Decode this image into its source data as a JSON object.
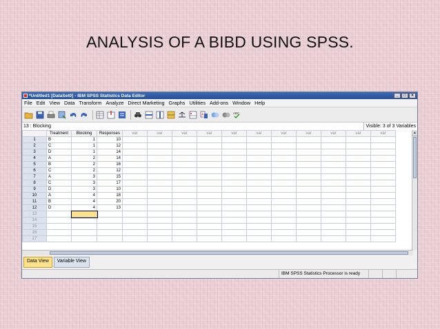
{
  "slide": {
    "title": "ANALYSIS OF A BIBD USING SPSS."
  },
  "window": {
    "title": "*Untitled1 [DataSet0] - IBM SPSS Statistics Data Editor",
    "controls": [
      "_",
      "□",
      "×"
    ]
  },
  "menu": [
    "File",
    "Edit",
    "View",
    "Data",
    "Transform",
    "Analyze",
    "Direct Marketing",
    "Graphs",
    "Utilities",
    "Add-ons",
    "Window",
    "Help"
  ],
  "toolbar_icons": [
    "open-icon",
    "save-icon",
    "print-icon",
    "recall-dialog-icon",
    "undo-icon",
    "redo-icon",
    "goto-case-icon",
    "goto-variable-icon",
    "variables-icon",
    "find-icon",
    "insert-cases-icon",
    "insert-variable-icon",
    "split-file-icon",
    "weight-cases-icon",
    "select-cases-icon",
    "value-labels-icon",
    "use-sets-icon",
    "show-all-variables-icon",
    "spell-check-icon"
  ],
  "cellbar": {
    "ref": "13 : Blocking",
    "visible": "Visible: 3 of 3 Variables"
  },
  "grid": {
    "headers": [
      "Treatment",
      "Blocking",
      "Responses"
    ],
    "var_label": "var",
    "var_count": 11,
    "rows": [
      [
        "1",
        "B",
        "1",
        "10"
      ],
      [
        "2",
        "C",
        "1",
        "12"
      ],
      [
        "3",
        "D",
        "1",
        "14"
      ],
      [
        "4",
        "A",
        "2",
        "14"
      ],
      [
        "5",
        "B",
        "2",
        "16"
      ],
      [
        "6",
        "C",
        "2",
        "12"
      ],
      [
        "7",
        "A",
        "3",
        "15"
      ],
      [
        "8",
        "C",
        "3",
        "17"
      ],
      [
        "9",
        "D",
        "3",
        "10"
      ],
      [
        "10",
        "A",
        "4",
        "18"
      ],
      [
        "11",
        "B",
        "4",
        "20"
      ],
      [
        "12",
        "D",
        "4",
        "13"
      ]
    ],
    "empty_rows": [
      "13",
      "14",
      "15",
      "16",
      "17"
    ],
    "selected": {
      "row": "13",
      "column": "Blocking"
    }
  },
  "tabs": [
    {
      "label": "Data View",
      "active": true
    },
    {
      "label": "Variable View",
      "active": false
    }
  ],
  "status": {
    "message": "IBM SPSS Statistics Processor is ready"
  },
  "colors": {
    "selected_cell": "#fde28a",
    "row_header": "#dde3ee",
    "titlebar": "#2f5ea6"
  }
}
